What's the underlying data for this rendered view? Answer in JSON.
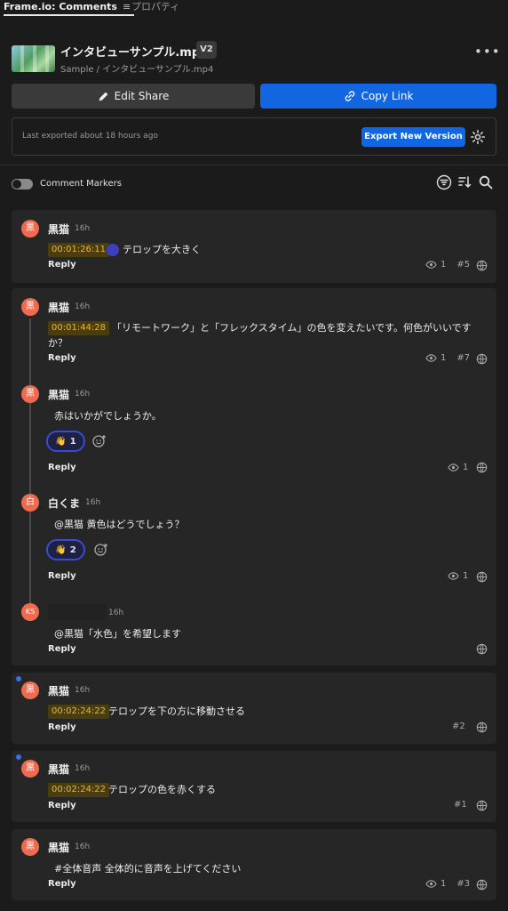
{
  "tabs": {
    "active": "Frame.io: Comments",
    "menu": "≡",
    "inactive": "プロパティ"
  },
  "header": {
    "file_title": "インタビューサンプル.mp4",
    "version": "V2",
    "breadcrumb": "Sample / インタビューサンプル.mp4",
    "more": "•••"
  },
  "share": {
    "edit_label": "Edit Share",
    "copy_label": "Copy Link"
  },
  "export": {
    "status": "Last exported about 18 hours ago",
    "button": "Export New Version"
  },
  "markers": {
    "label": "Comment Markers",
    "enabled": true
  },
  "colors": {
    "accent": "#1266e2",
    "timestamp": "#e3b83d",
    "avatar": "#f06a4f"
  },
  "comments": [
    {
      "avatar": "黒",
      "author": "黒猫",
      "time": "16h",
      "timestamp": "00:01:26:11",
      "text": "テロップを大きく",
      "reply": "Reply",
      "views": "1",
      "number": "#5"
    },
    {
      "avatar": "黒",
      "author": "黒猫",
      "time": "16h",
      "timestamp": "00:01:44:28",
      "text_line1": "「リモートワーク」と「フレックスタイム」の色を変えたいです。何色がいいです",
      "text_line2": "か？",
      "reply": "Reply",
      "views": "1",
      "number": "#7",
      "replies": [
        {
          "avatar": "黒",
          "author": "黒猫",
          "time": "16h",
          "text": "赤はいかがでしょうか。",
          "reaction_emoji": "👋",
          "reaction_count": "1",
          "reply": "Reply",
          "views": "1"
        },
        {
          "avatar": "白",
          "author": "白くま",
          "time": "16h",
          "text": "@黒猫 黄色はどうでしょう？",
          "reaction_emoji": "👋",
          "reaction_count": "2",
          "reply": "Reply",
          "views": "1"
        },
        {
          "avatar": "KS",
          "author": "",
          "time": "16h",
          "text": "@黒猫「水色」を希望します",
          "reply": "Reply"
        }
      ]
    },
    {
      "avatar": "黒",
      "author": "黒猫",
      "time": "16h",
      "timestamp": "00:02:24:22",
      "text": "テロップを下の方に移動させる",
      "reply": "Reply",
      "number": "#2"
    },
    {
      "avatar": "黒",
      "author": "黒猫",
      "time": "16h",
      "timestamp": "00:02:24:22",
      "text": "テロップの色を赤くする",
      "reply": "Reply",
      "number": "#1"
    },
    {
      "avatar": "黒",
      "author": "黒猫",
      "time": "16h",
      "text": "#全体音声 全体的に音声を上げてください",
      "reply": "Reply",
      "views": "1",
      "number": "#3"
    }
  ]
}
